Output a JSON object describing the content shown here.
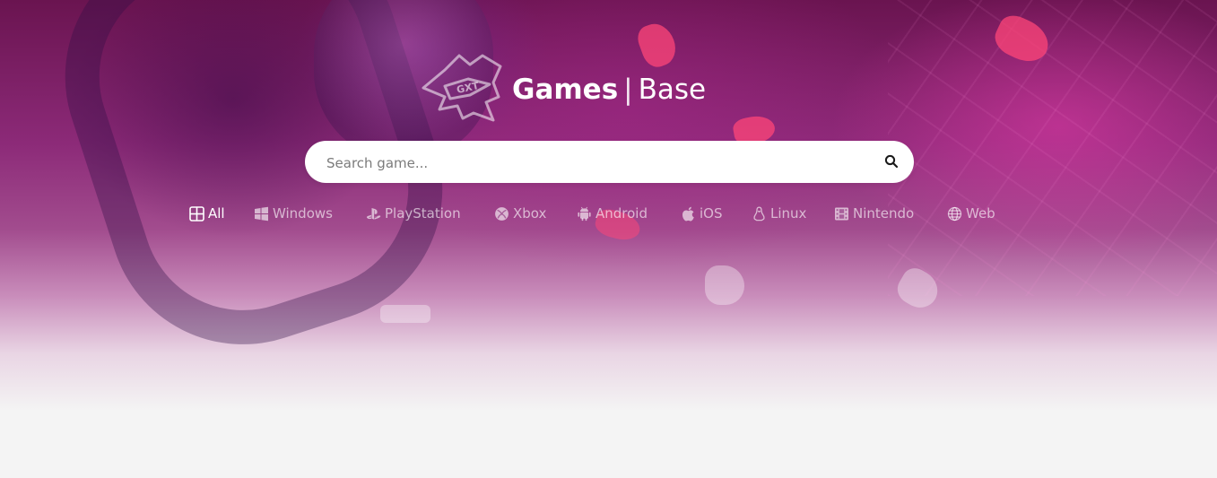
{
  "header": {
    "title_bold": "Games",
    "title_separator": "|",
    "title_light": "Base",
    "logo_icon": "gxt-shield-logo"
  },
  "search": {
    "placeholder": "Search game...",
    "value": "",
    "icon": "search-icon"
  },
  "platforms": [
    {
      "label": "All",
      "icon": "grid-icon",
      "active": true
    },
    {
      "label": "Windows",
      "icon": "windows-icon",
      "active": false
    },
    {
      "label": "PlayStation",
      "icon": "playstation-icon",
      "active": false
    },
    {
      "label": "Xbox",
      "icon": "xbox-icon",
      "active": false
    },
    {
      "label": "Android",
      "icon": "android-icon",
      "active": false
    },
    {
      "label": "iOS",
      "icon": "apple-icon",
      "active": false
    },
    {
      "label": "Linux",
      "icon": "linux-icon",
      "active": false
    },
    {
      "label": "Nintendo",
      "icon": "nintendo-icon",
      "active": false
    },
    {
      "label": "Web",
      "icon": "globe-icon",
      "active": false
    }
  ],
  "colors": {
    "hero_top": "#6a1450",
    "hero_mid": "#a24c8e",
    "page_background": "#f4f4f4",
    "accent": "#ff4678"
  }
}
